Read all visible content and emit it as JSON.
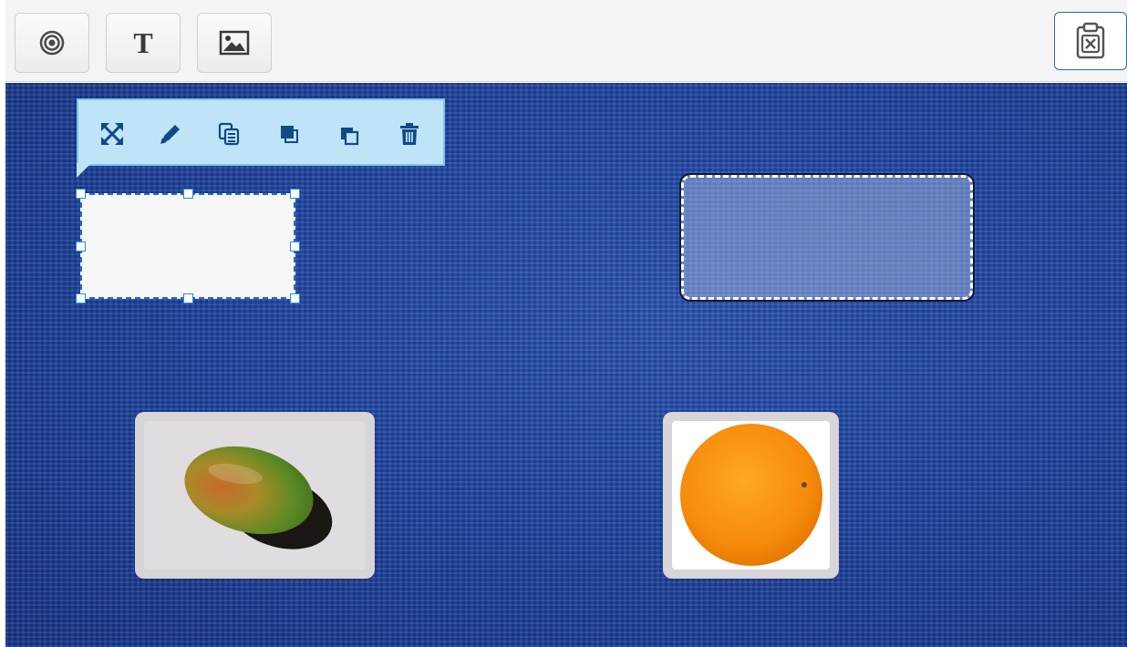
{
  "toolbar": {
    "tools": [
      {
        "name": "target-tool-button",
        "icon": "target-icon",
        "label": ""
      },
      {
        "name": "text-tool-button",
        "icon": "text-icon",
        "label": "T"
      },
      {
        "name": "image-tool-button",
        "icon": "image-icon",
        "label": ""
      }
    ],
    "clear": {
      "name": "clear-clipboard-button",
      "icon": "clipboard-x-icon"
    }
  },
  "context_toolbar": {
    "actions": [
      {
        "name": "fullscreen-button",
        "icon": "expand-icon"
      },
      {
        "name": "edit-button",
        "icon": "pencil-icon"
      },
      {
        "name": "copy-button",
        "icon": "copy-icon"
      },
      {
        "name": "bring-front-button",
        "icon": "bring-front-icon"
      },
      {
        "name": "send-back-button",
        "icon": "send-back-icon"
      },
      {
        "name": "delete-button",
        "icon": "trash-icon"
      }
    ]
  },
  "canvas": {
    "text_box": {
      "value": ""
    },
    "drop_zone": {
      "value": ""
    },
    "images": [
      {
        "name": "mango-image-card",
        "depicts": "mango"
      },
      {
        "name": "orange-image-card",
        "depicts": "orange"
      }
    ]
  },
  "colors": {
    "canvas_bg": "#1f46a5",
    "toolbar_icon": "#114a86",
    "context_bg": "#bfe4f8",
    "selection": "#1f8fe0"
  }
}
